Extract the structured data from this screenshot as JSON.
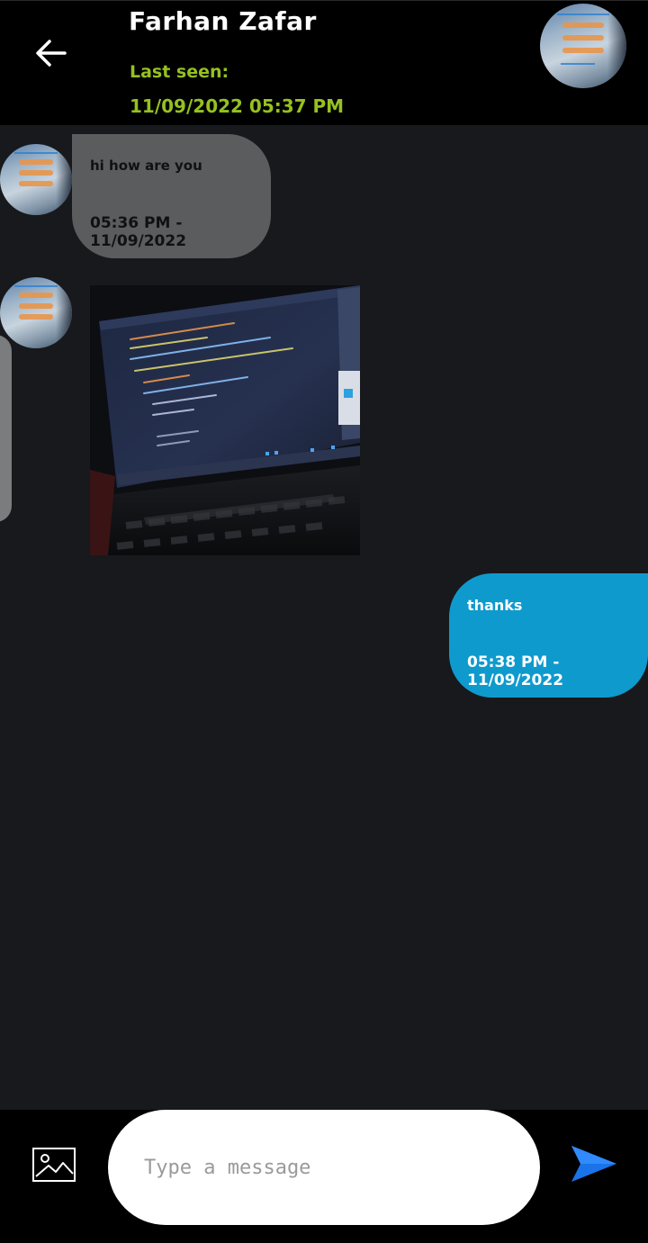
{
  "header": {
    "contact_name": "Farhan Zafar",
    "last_seen_label": "Last seen:",
    "last_seen_time": "11/09/2022 05:37 PM",
    "back_icon": "arrow-left-icon",
    "avatar_icon": "contact-avatar"
  },
  "messages": [
    {
      "direction": "incoming",
      "type": "text",
      "text": "hi how are you",
      "time": "05:36 PM - 11/09/2022"
    },
    {
      "direction": "incoming",
      "type": "image",
      "image_description": "laptop-screen-code-photo"
    },
    {
      "direction": "outgoing",
      "type": "text",
      "text": "thanks",
      "time": "05:38 PM - 11/09/2022"
    }
  ],
  "composer": {
    "placeholder": "Type a message",
    "value": "",
    "gallery_icon": "image-icon",
    "send_icon": "send-icon"
  },
  "colors": {
    "background": "#17191c",
    "header": "#000000",
    "accent_green": "#95c11f",
    "incoming_bubble": "#5b5c5e",
    "outgoing_bubble": "#0f9acd",
    "send_blue": "#1a73e8"
  }
}
